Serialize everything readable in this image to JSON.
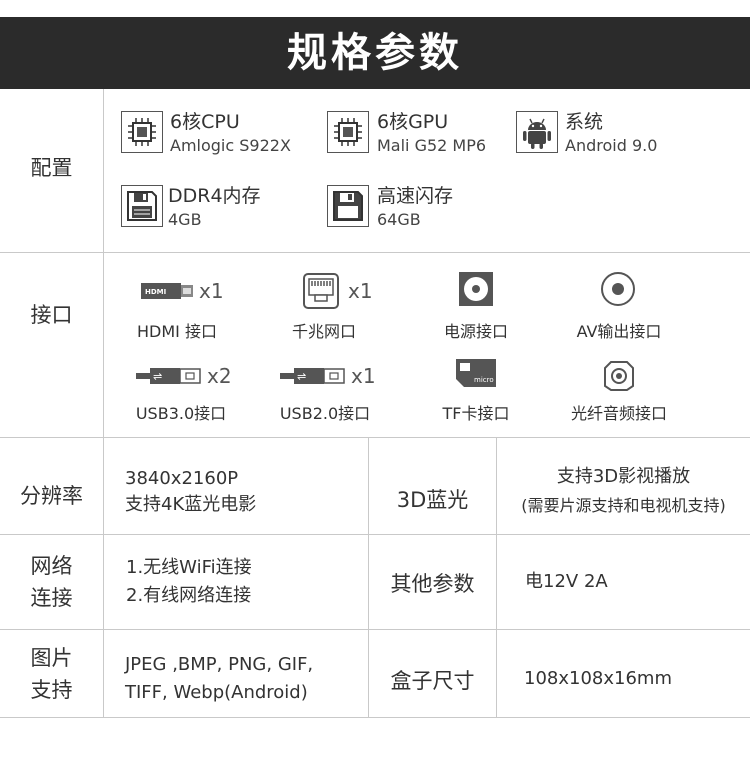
{
  "header": {
    "title": "规格参数"
  },
  "config": {
    "label": "配置",
    "items": [
      {
        "icon": "cpu-icon",
        "title": "6核CPU",
        "value": "Amlogic S922X"
      },
      {
        "icon": "gpu-icon",
        "title": "6核GPU",
        "value": "Mali G52 MP6"
      },
      {
        "icon": "android-icon",
        "title": "系统",
        "value": "Android 9.0"
      },
      {
        "icon": "ram-icon",
        "title": "DDR4内存",
        "value": "4GB"
      },
      {
        "icon": "storage-icon",
        "title": "高速闪存",
        "value": "64GB"
      }
    ]
  },
  "ports": {
    "label": "接口",
    "items": [
      {
        "icon": "hdmi-icon",
        "count": "x1",
        "label": "HDMI 接口"
      },
      {
        "icon": "ethernet-icon",
        "count": "x1",
        "label": "千兆网口"
      },
      {
        "icon": "power-icon",
        "count": "",
        "label": "电源接口"
      },
      {
        "icon": "av-icon",
        "count": "",
        "label": "AV输出接口"
      },
      {
        "icon": "usb3-icon",
        "count": "x2",
        "label": "USB3.0接口"
      },
      {
        "icon": "usb2-icon",
        "count": "x1",
        "label": "USB2.0接口"
      },
      {
        "icon": "tf-card-icon",
        "count": "",
        "label": "TF卡接口"
      },
      {
        "icon": "optical-icon",
        "count": "",
        "label": "光纤音频接口"
      }
    ]
  },
  "resolution": {
    "label": "分辨率",
    "line1": "3840x2160P",
    "line2": "支持4K蓝光电影"
  },
  "bluray": {
    "label": "3D蓝光",
    "line1": "支持3D影视播放",
    "line2": "(需要片源支持和电视机支持)"
  },
  "network": {
    "label_line1": "网络",
    "label_line2": "连接",
    "line1": "1.无线WiFi连接",
    "line2": "2.有线网络连接"
  },
  "other": {
    "label": "其他参数",
    "value": "电12V 2A"
  },
  "images": {
    "label_line1": "图片",
    "label_line2": "支持",
    "line1": "JPEG ,BMP, PNG, GIF,",
    "line2": "TIFF, Webp(Android)"
  },
  "box": {
    "label": "盒子尺寸",
    "value": "108x108x16mm"
  }
}
